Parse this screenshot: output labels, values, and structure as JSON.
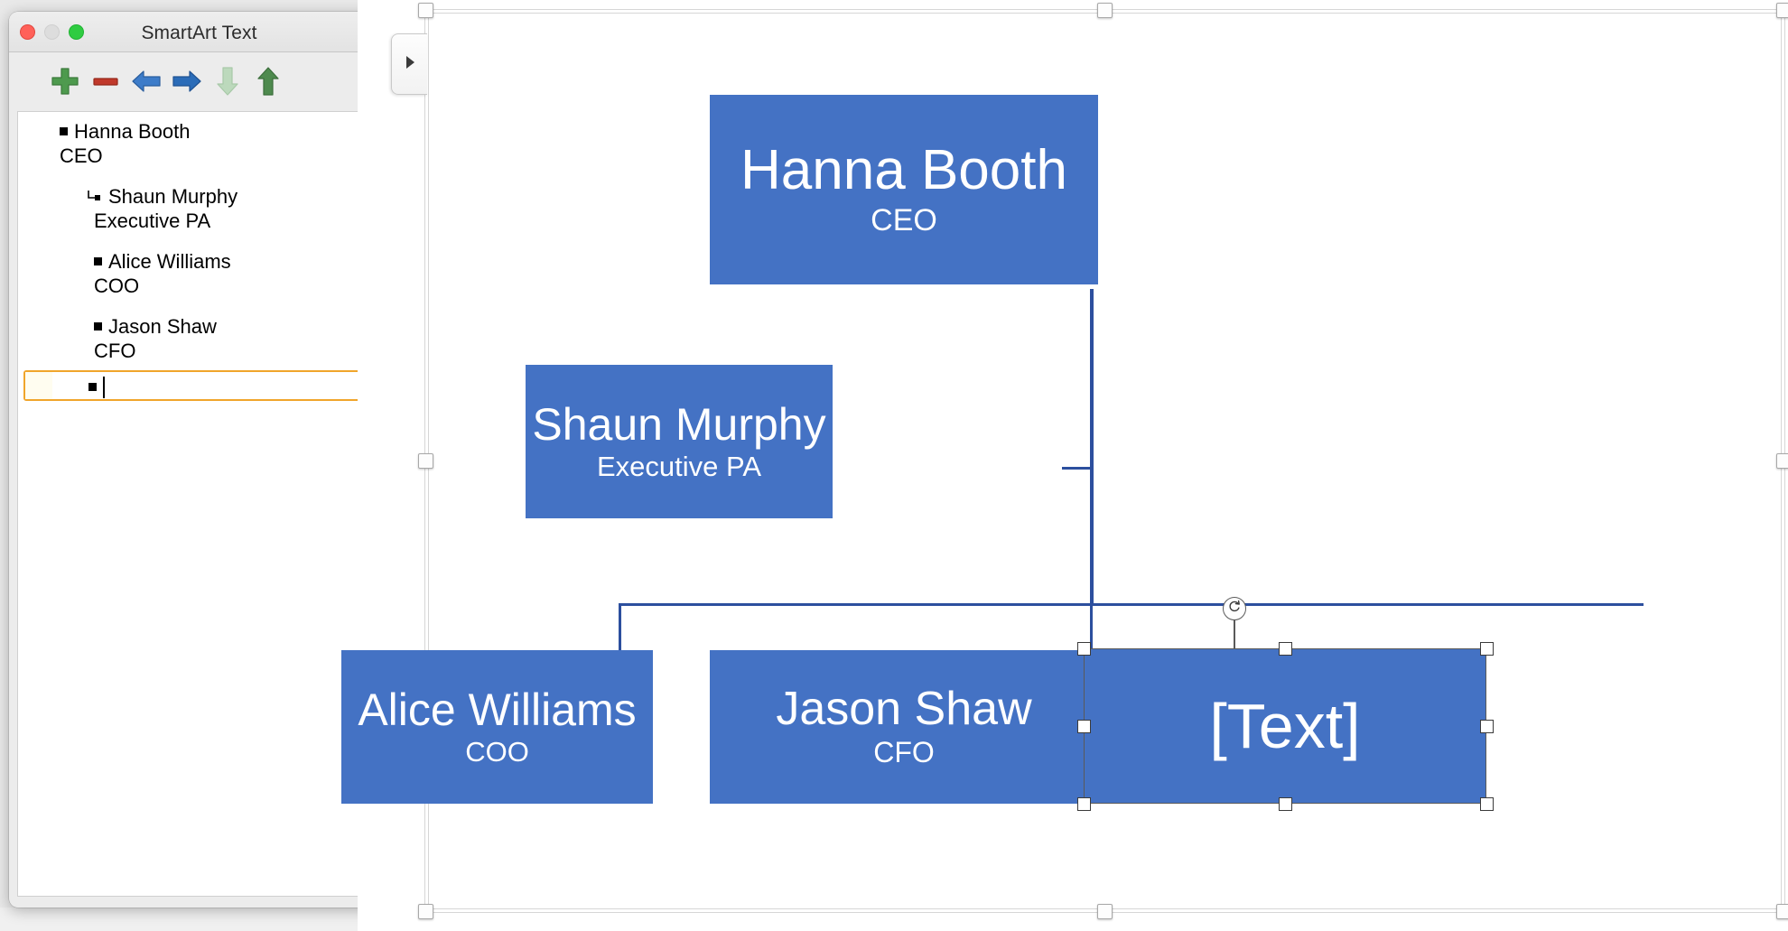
{
  "window": {
    "title": "SmartArt Text",
    "controls": {
      "close": "close-button",
      "minimize": "minimize-button",
      "maximize": "maximize-button"
    }
  },
  "toolbar": {
    "buttons": [
      {
        "name": "add-shape-button",
        "icon": "plus-icon",
        "label": "Add Shape",
        "color": "#4e9a4e",
        "enabled": true
      },
      {
        "name": "remove-shape-button",
        "icon": "minus-icon",
        "label": "Remove Shape",
        "color": "#c0392b",
        "enabled": true
      },
      {
        "name": "promote-button",
        "icon": "arrow-left-icon",
        "label": "Promote",
        "color": "#3d7cc9",
        "enabled": true
      },
      {
        "name": "demote-button",
        "icon": "arrow-right-icon",
        "label": "Demote",
        "color": "#2b6cb8",
        "enabled": true
      },
      {
        "name": "move-down-button",
        "icon": "arrow-down-icon",
        "label": "Move Down",
        "color": "#b8d6b8",
        "enabled": false
      },
      {
        "name": "move-up-button",
        "icon": "arrow-up-icon",
        "label": "Move Up",
        "color": "#4e8a4e",
        "enabled": true
      }
    ]
  },
  "text_panel": {
    "entries": [
      {
        "level": 1,
        "bullet": "square",
        "name": "Hanna Booth",
        "role": "CEO"
      },
      {
        "level": 2,
        "bullet": "assistant",
        "name": "Shaun Murphy",
        "role": "Executive PA"
      },
      {
        "level": 2,
        "bullet": "square",
        "name": "Alice Williams",
        "role": "COO"
      },
      {
        "level": 2,
        "bullet": "square",
        "name": "Jason Shaw",
        "role": "CFO"
      }
    ],
    "active_entry": {
      "level": 2,
      "bullet": "square",
      "value": "",
      "placeholder": "",
      "caret_visible": true,
      "highlight_color": "#f0a52b"
    }
  },
  "chart_data": {
    "type": "diagram",
    "layout": "organization-chart",
    "title": "",
    "node_fill": "#4472c4",
    "node_text_color": "#ffffff",
    "connector_color": "#2c4f9e",
    "nodes": [
      {
        "id": "ceo",
        "name": "Hanna Booth",
        "role": "CEO",
        "level": 1,
        "kind": "manager"
      },
      {
        "id": "asst",
        "name": "Shaun Murphy",
        "role": "Executive PA",
        "level": 2,
        "kind": "assistant",
        "parent": "ceo"
      },
      {
        "id": "coo",
        "name": "Alice Williams",
        "role": "COO",
        "level": 2,
        "kind": "subordinate",
        "parent": "ceo"
      },
      {
        "id": "cfo",
        "name": "Jason Shaw",
        "role": "CFO",
        "level": 2,
        "kind": "subordinate",
        "parent": "ceo"
      },
      {
        "id": "new",
        "name": "[Text]",
        "role": "",
        "level": 2,
        "kind": "subordinate",
        "parent": "ceo",
        "selected": true
      }
    ]
  },
  "canvas": {
    "selected_shape": {
      "placeholder_text": "[Text]",
      "handles": 8,
      "rotation_handle": "rotate-icon"
    },
    "collapse_tab": "expand-text-pane-arrow"
  }
}
